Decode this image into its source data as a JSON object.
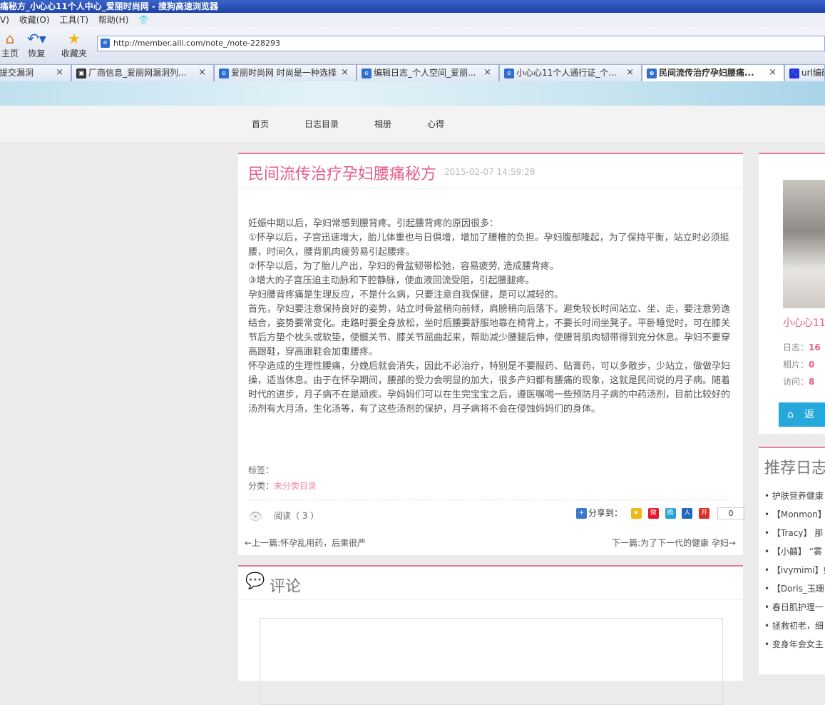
{
  "browser": {
    "title": "痛秘方_小心心11个人中心_爱丽时尚网 - 搜狗高速浏览器",
    "menu": [
      "V)",
      "收藏(O)",
      "工具(T)",
      "帮助(H)"
    ],
    "toolbar": {
      "home": "主页",
      "restore": "恢复",
      "favorites": "收藏夹"
    },
    "address": "http://member.aili.com/note_/note-228293",
    "tabs": [
      {
        "label": "提交漏洞"
      },
      {
        "label": "厂商信息_爱丽网漏洞列..."
      },
      {
        "label": "爱丽时尚网 时尚是一种选择"
      },
      {
        "label": "编辑日志_个人空间_爱丽..."
      },
      {
        "label": "小心心11个人通行证_个..."
      },
      {
        "label": "民间流传治疗孕妇腰痛..."
      },
      {
        "label": "url编码"
      }
    ],
    "close_glyph": "×"
  },
  "nav": {
    "items": [
      "首页",
      "日志目录",
      "相册",
      "心得"
    ]
  },
  "article": {
    "title": "民间流传治疗孕妇腰痛秘方",
    "date": "2015-02-07 14:59:28",
    "paragraphs": [
      "妊娠中期以后，孕妇常感到腰背疼。引起腰背疼的原因很多：",
      "①怀孕以后，子宫迅速增大，胎儿体重也与日俱增，增加了腰椎的负担。孕妇腹部隆起，为了保持平衡，站立时必须挺腰，时间久，腰背肌肉疲劳易引起腰疼。",
      "②怀孕以后，为了胎儿产出，孕妇的骨盆韧带松弛，容易疲劳, 造成腰背疼。",
      "③增大的子宫压迫主动脉和下腔静脉，使血液回流受阻，引起腰腿疼。",
      "孕妇腰背疼痛是生理反应，不是什么病，只要注意自我保健，是可以减轻的。",
      "首先，孕妇要注意保持良好的姿势，站立时骨盆稍向前倾，肩膀稍向后落下。避免较长时间站立、坐、走，要注意劳逸结合，姿势要常变化。走路时要全身放松，坐时后腰要舒服地靠在椅背上，不要长时间坐凳子。平卧睡觉时，可在膝关节后方垫个枕头或软垫，使髋关节、膝关节屈曲起来，帮助减少腰腿后伸，使腰背肌肉韧带得到充分休息。孕妇不要穿高跟鞋，穿高跟鞋会加重腰疼。",
      "怀孕造成的生理性腰痛，分娩后就会消失，因此不必治疗，特别是不要服药、贴膏药，可以多散步，少站立，做做孕妇操，适当休息。由于在怀孕期间，腰部的受力会明显的加大，很多产妇都有腰痛的现象，这就是民间说的月子病。随着时代的进步，月子病不在是顽疾。孕妈妈们可以在生完宝宝之后，遵医嘱喝一些预防月子病的中药汤剂，目前比较好的汤剂有大月汤，生化汤等，有了这些汤剂的保护，月子病将不会在侵蚀妈妈们的身体。"
    ],
    "tags_label": "标签：",
    "category_label": "分类：",
    "category_value": "未分类目录",
    "reads": "阅读（ 3 ）",
    "share_label": "分享到：",
    "share_count": "0"
  },
  "pager": {
    "prev": "←上一篇:怀孕乱用药，后果很严",
    "next": "下一篇:为了下一代的健康 孕妇→"
  },
  "comments": {
    "title": "评论"
  },
  "profile": {
    "name": "小心心11",
    "stats": [
      {
        "label": "日志：",
        "value": "16"
      },
      {
        "label": "相片：",
        "value": "0"
      },
      {
        "label": "访问：",
        "value": "8"
      }
    ],
    "back_label": "返"
  },
  "recommend": {
    "title": "推荐日志",
    "items": [
      "护肤营养健康",
      "【Monmon】",
      "【Tracy】 那",
      "【小囍】 “雾",
      "【ivymimi】如",
      "【Doris_玉珊",
      "春日肌护理一",
      "拯救初老，细",
      "变身年会女主"
    ]
  },
  "colors": {
    "accent": "#e35f8a",
    "button": "#25a8dc"
  }
}
